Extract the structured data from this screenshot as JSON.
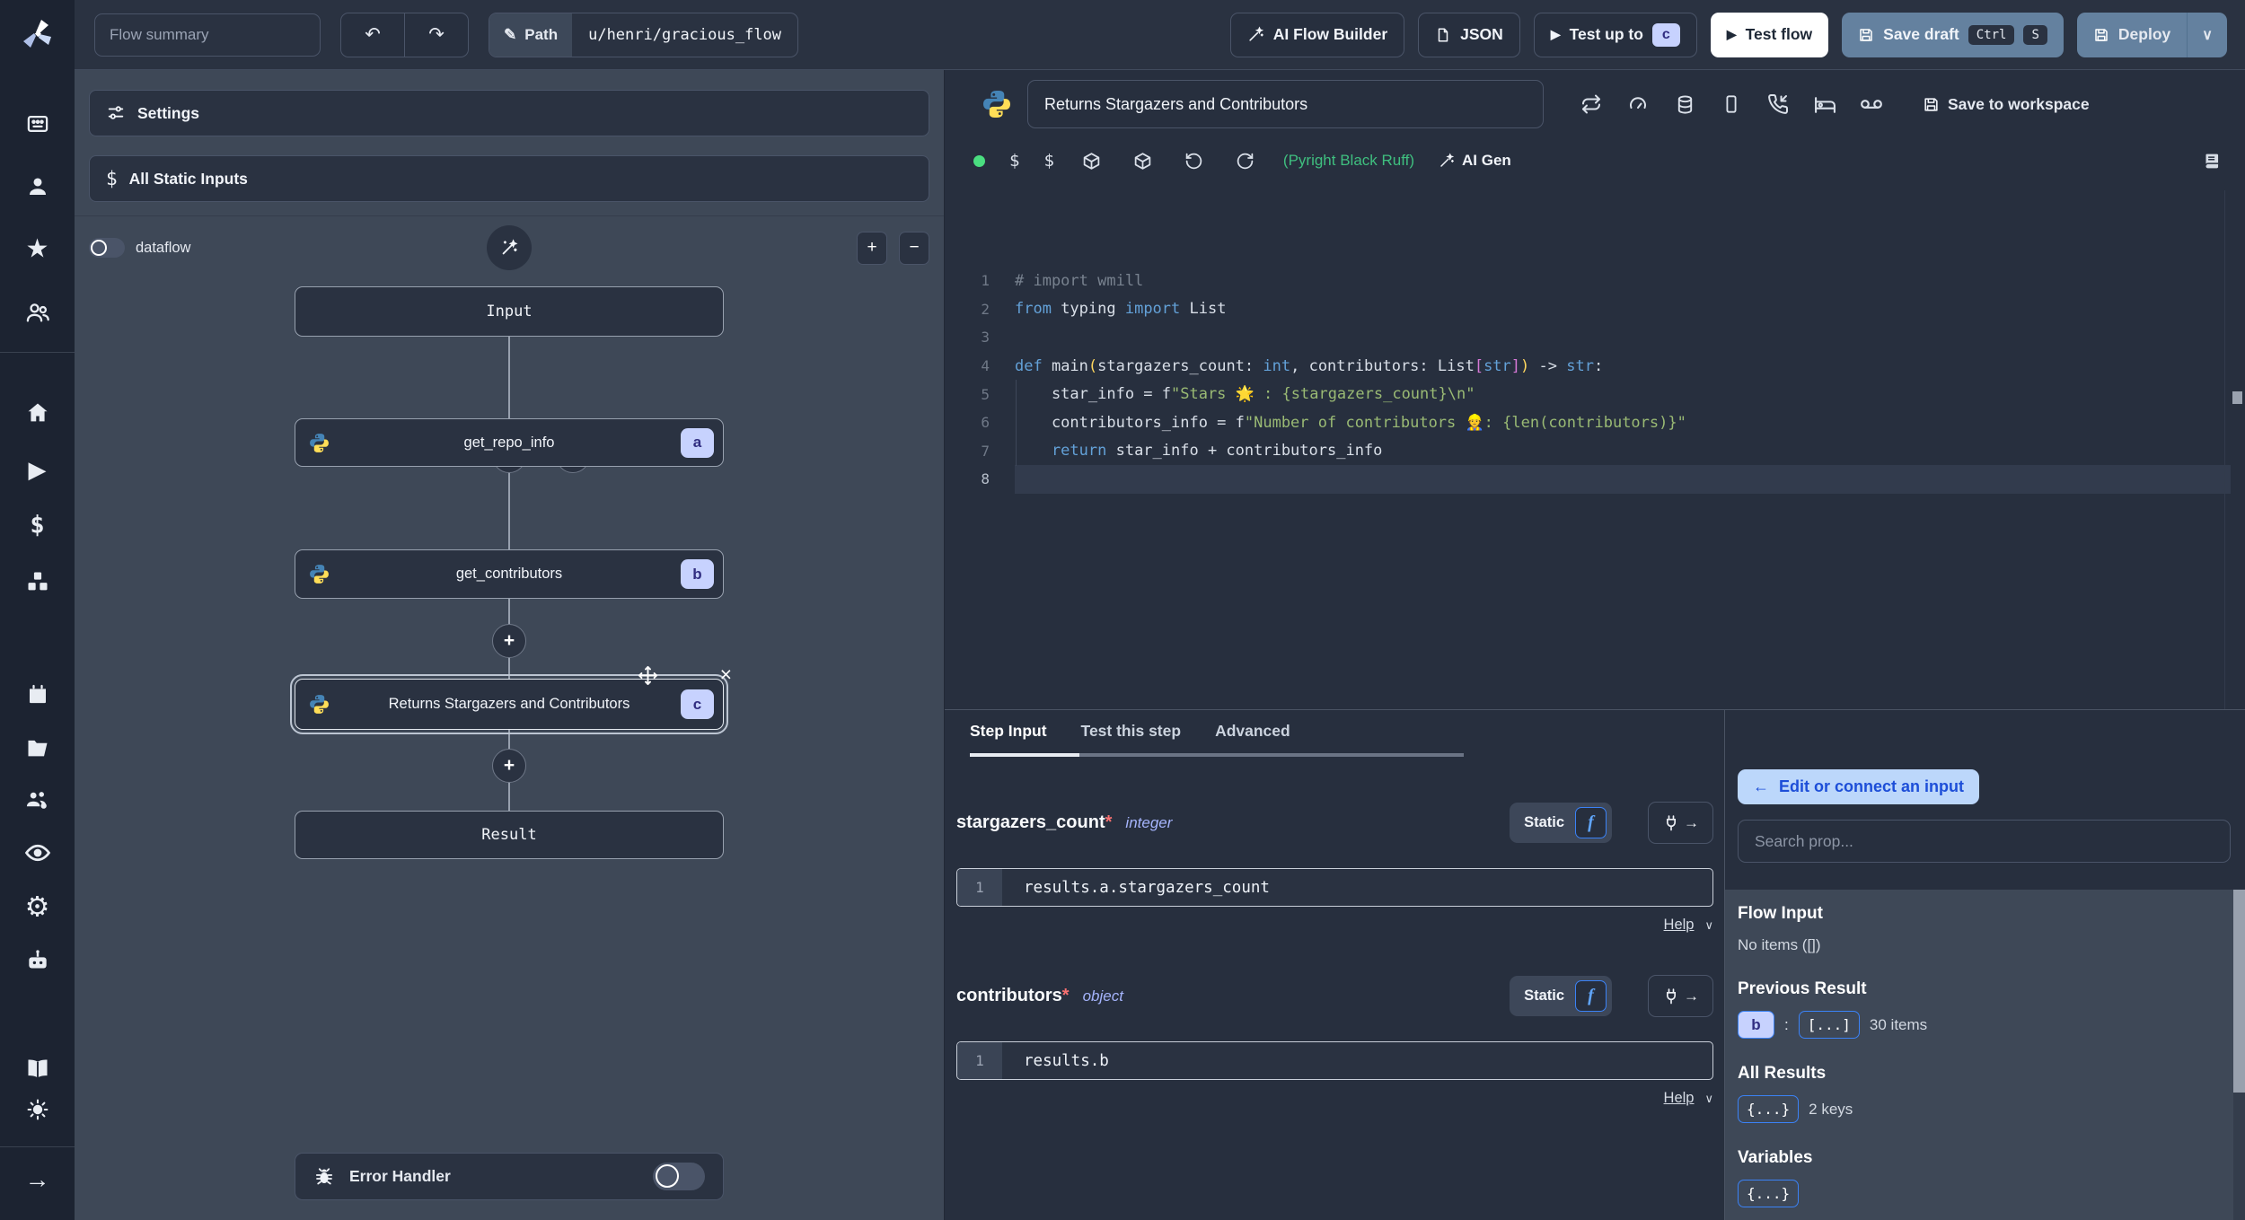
{
  "colors": {
    "accent": "#3b82f6",
    "badge_bg": "#c7d2fe",
    "badge_text": "#312e81",
    "steel_button": "#64819f",
    "success_green": "#4ade80",
    "lint_green": "#3fbf7f"
  },
  "icons": {
    "star": "★",
    "play": "▶",
    "arrow_right": "→",
    "dollar": "$",
    "gear": "⚙",
    "undo": "↶",
    "redo": "↷",
    "pencil": "✎",
    "close": "×",
    "plus": "+",
    "minus": "−",
    "chevron_down": "∨",
    "back_arrow": "←",
    "colon": ":"
  },
  "topbar": {
    "flow_summary_placeholder": "Flow summary",
    "path_label": "Path",
    "path_value": "u/henri/gracious_flow",
    "ai_flow_builder": "AI Flow Builder",
    "json_button": "JSON",
    "test_up_to": "Test up to",
    "test_up_to_step_badge": "c",
    "test_flow": "Test flow",
    "save_draft": "Save draft",
    "kbd_ctrl": "Ctrl",
    "kbd_s": "S",
    "deploy": "Deploy"
  },
  "flow_panel": {
    "settings": "Settings",
    "all_static_inputs": "All Static Inputs",
    "dataflow": "dataflow",
    "input_node": "Input",
    "steps": [
      {
        "label": "get_repo_info",
        "badge": "a"
      },
      {
        "label": "get_contributors",
        "badge": "b"
      },
      {
        "label": "Returns Stargazers and Contributors",
        "badge": "c"
      }
    ],
    "result_node": "Result",
    "error_handler": "Error Handler"
  },
  "editor": {
    "title": "Returns Stargazers and Contributors",
    "save_to_workspace": "Save to workspace",
    "lint_status": "(Pyright Black Ruff)",
    "ai_gen": "AI Gen",
    "active_line": 8,
    "code_lines": [
      [
        [
          "cmt",
          "# import wmill"
        ]
      ],
      [
        [
          "kw",
          "from"
        ],
        [
          "pln",
          " typing "
        ],
        [
          "kw",
          "import"
        ],
        [
          "pln",
          " List"
        ]
      ],
      [],
      [
        [
          "kw",
          "def"
        ],
        [
          "pln",
          " main"
        ],
        [
          "par",
          "("
        ],
        [
          "pln",
          "stargazers_count: "
        ],
        [
          "kw",
          "int"
        ],
        [
          "pln",
          ", contributors: List"
        ],
        [
          "brk",
          "["
        ],
        [
          "kw",
          "str"
        ],
        [
          "brk",
          "]"
        ],
        [
          "par",
          ")"
        ],
        [
          "pln",
          " -> "
        ],
        [
          "kw",
          "str"
        ],
        [
          "pln",
          ":"
        ]
      ],
      [
        [
          "pln",
          "    star_info = f"
        ],
        [
          "str",
          "\"Stars 🌟 : {stargazers_count}\\n\""
        ]
      ],
      [
        [
          "pln",
          "    contributors_info = f"
        ],
        [
          "str",
          "\"Number of contributors 👷: {len(contributors)}\""
        ]
      ],
      [
        [
          "kw",
          "    return"
        ],
        [
          "pln",
          " star_info + contributors_info"
        ]
      ],
      []
    ]
  },
  "step_panel": {
    "tabs": [
      "Step Input",
      "Test this step",
      "Advanced"
    ],
    "fields": [
      {
        "name": "stargazers_count",
        "required_mark": "*",
        "type": "integer",
        "mode": "Static",
        "line_no": "1",
        "expr": "results.a.stargazers_count",
        "help": "Help"
      },
      {
        "name": "contributors",
        "required_mark": "*",
        "type": "object",
        "mode": "Static",
        "line_no": "1",
        "expr": "results.b",
        "help": "Help"
      }
    ]
  },
  "connect_panel": {
    "edit_button": "Edit or connect an input",
    "search_placeholder": "Search prop...",
    "flow_input_title": "Flow Input",
    "flow_input_empty": "No items ([])",
    "previous_result_title": "Previous Result",
    "previous_result_badge": "b",
    "previous_result_value": "[...]",
    "previous_result_count": "30 items",
    "all_results_title": "All Results",
    "all_results_value": "{...}",
    "all_results_count": "2 keys",
    "variables_title": "Variables",
    "variables_value": "{...}"
  }
}
